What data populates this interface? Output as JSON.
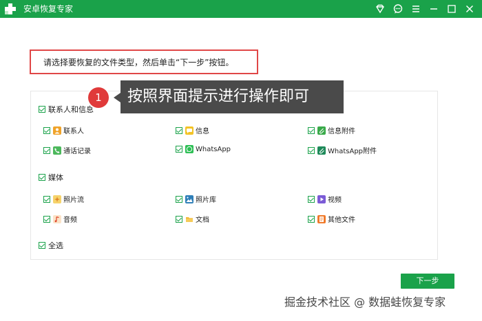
{
  "app": {
    "title": "安卓恢复专家"
  },
  "instruction": "请选择要恢复的文件类型，然后单击“下一步”按钮。",
  "callout": {
    "number": "1",
    "text": "按照界面提示进行操作即可"
  },
  "groups": [
    {
      "label": "联系人和信息",
      "items": [
        {
          "label": "联系人",
          "icon": "contact-icon"
        },
        {
          "label": "信息",
          "icon": "message-icon"
        },
        {
          "label": "信息附件",
          "icon": "attachment-icon"
        },
        {
          "label": "通话记录",
          "icon": "phone-icon"
        },
        {
          "label": "WhatsApp",
          "icon": "whatsapp-icon"
        },
        {
          "label": "WhatsApp附件",
          "icon": "whatsapp-attachment-icon"
        }
      ]
    },
    {
      "label": "媒体",
      "items": [
        {
          "label": "照片流",
          "icon": "photo-stream-icon"
        },
        {
          "label": "照片库",
          "icon": "photo-library-icon"
        },
        {
          "label": "视频",
          "icon": "video-icon"
        },
        {
          "label": "音频",
          "icon": "audio-icon"
        },
        {
          "label": "文档",
          "icon": "folder-icon"
        },
        {
          "label": "其他文件",
          "icon": "file-icon"
        }
      ]
    }
  ],
  "select_all": "全选",
  "next_button": "下一步",
  "watermark": "掘金技术社区 @ 数据蛙恢复专家",
  "colors": {
    "brand": "#1aa24a",
    "highlight": "#e04646",
    "callout_bg": "#4a4a4a"
  }
}
